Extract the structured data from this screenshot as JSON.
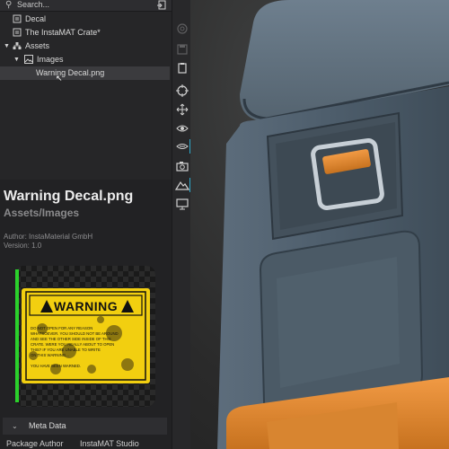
{
  "search": {
    "placeholder": "Search..."
  },
  "tree": {
    "items": [
      {
        "label": "Decal"
      },
      {
        "label": "The InstaMAT Crate*"
      },
      {
        "label": "Assets"
      },
      {
        "label": "Images"
      },
      {
        "label": "Warning Decal.png"
      }
    ]
  },
  "asset": {
    "name": "Warning Decal.png",
    "path": "Assets/Images",
    "author": "Author: InstaMaterial GmbH",
    "version": "Version: 1.0"
  },
  "decal": {
    "heading": "WARNING",
    "body": [
      "DO NOT OPEN FOR ANY REASON",
      "WHATSOEVER. YOU SHOULD NOT BE AROUND",
      "AND SEE THE OTHER SIDE INSIDE OF THIS",
      "CRATE. WERE YOU REALLY ABOUT TO OPEN",
      "THIS? IF YOU ARE UNABLE TO WRITE",
      "ON THIS WARNING...",
      "YOU HAVE BEEN WARNED."
    ]
  },
  "metadata": {
    "header": "Meta Data",
    "rows": [
      {
        "key": "Package Author",
        "value": "InstaMAT Studio"
      }
    ]
  },
  "toolbar": {
    "icons": [
      "globe-icon",
      "save-icon",
      "clipboard-icon",
      "target-icon",
      "move-icon",
      "eye-scan-icon",
      "scene-visibility-icon",
      "camera-icon",
      "terrain-icon",
      "display-icon"
    ]
  },
  "colors": {
    "accent": "#2ea7c9",
    "green_bar": "#2bd12b",
    "decal_yellow": "#f2cf10"
  }
}
